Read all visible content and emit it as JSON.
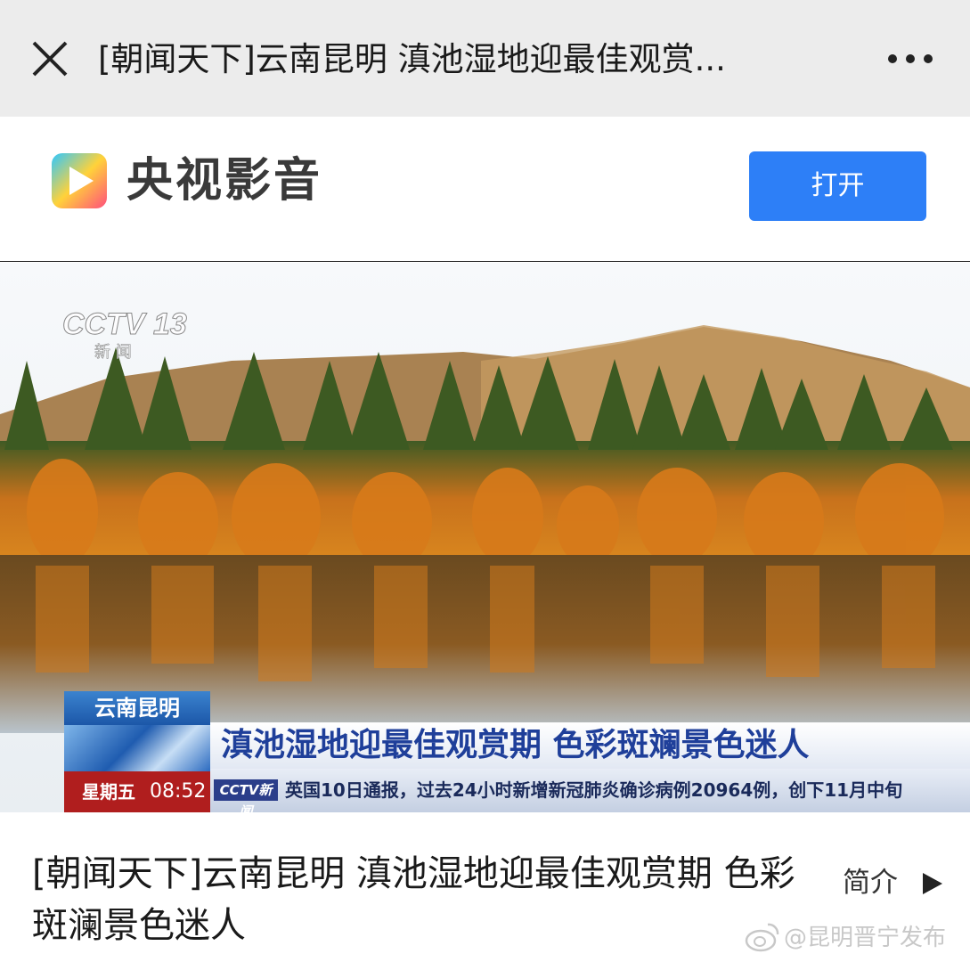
{
  "topbar": {
    "title": "[朝闻天下]云南昆明 滇池湿地迎最佳观赏..."
  },
  "appbar": {
    "app_name": "央视影音",
    "open_label": "打开",
    "brand_color": "#2d7ff7"
  },
  "video": {
    "channel_logo": "CCTV 13",
    "channel_sub": "新 闻",
    "location_tag": "云南昆明",
    "headline": "滇池湿地迎最佳观赏期 色彩斑斓景色迷人",
    "day": "星期五",
    "time": "08:52",
    "ticker_logo": "CCTV新闻",
    "ticker": "英国10日通报，过去24小时新增新冠肺炎确诊病例20964例，创下11月中旬"
  },
  "content": {
    "title": "[朝闻天下]云南昆明 滇池湿地迎最佳观赏期 色彩斑澜景色迷人",
    "intro_label": "简介"
  },
  "watermark": {
    "text": "@昆明晋宁发布"
  },
  "icons": [
    "close-icon",
    "more-icon",
    "app-logo-icon",
    "play-icon",
    "weibo-icon"
  ]
}
